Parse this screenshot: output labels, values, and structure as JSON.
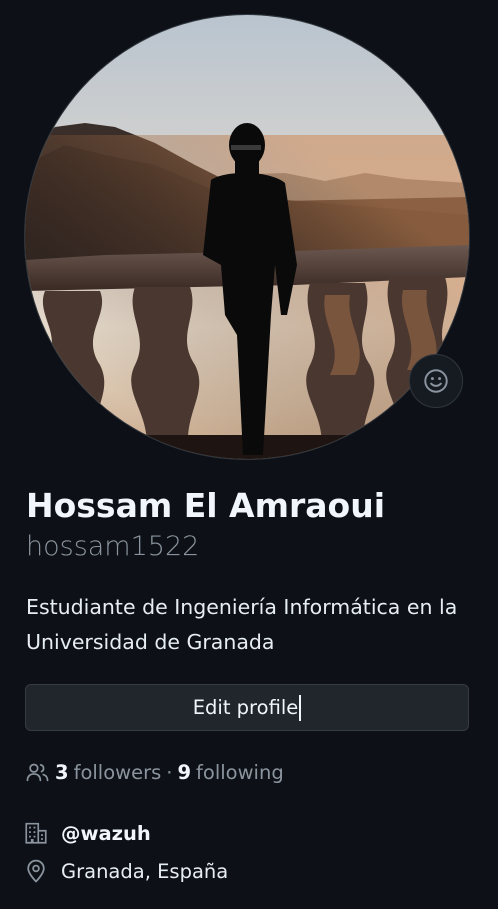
{
  "profile": {
    "full_name": "Hossam El Amraoui",
    "username": "hossam1522",
    "bio": "Estudiante de Ingeniería Informática en la Universidad de Granada",
    "avatar_alt": "avatar photo",
    "status_icon": "smiley-icon",
    "edit_button": "Edit profile",
    "followers": {
      "count": "3",
      "label": "followers"
    },
    "separator": "·",
    "following": {
      "count": "9",
      "label": "following"
    },
    "organization": "@wazuh",
    "location": "Granada, España"
  },
  "colors": {
    "background": "#0d1117",
    "text_primary": "#f0f6fc",
    "text_muted": "#8b949e",
    "button_bg": "#21262d",
    "border": "#30363d"
  }
}
